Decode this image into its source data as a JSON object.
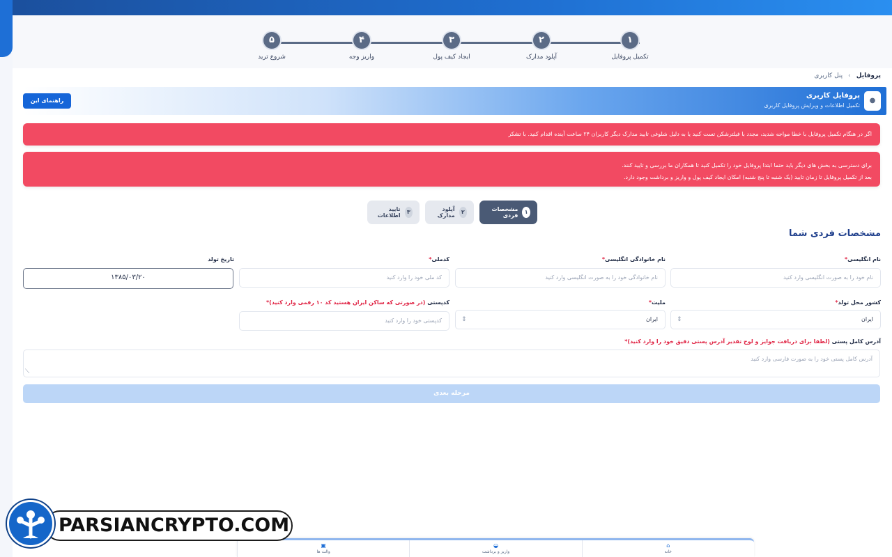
{
  "stepper": {
    "steps": [
      {
        "num": "۱",
        "label": "تکمیل پروفایل"
      },
      {
        "num": "۲",
        "label": "آپلود مدارک"
      },
      {
        "num": "۳",
        "label": "ایجاد کیف پول"
      },
      {
        "num": "۴",
        "label": "واریز وجه"
      },
      {
        "num": "۵",
        "label": "شروع ترید"
      }
    ]
  },
  "breadcrumb": {
    "root": "پنل کاربری",
    "separator": "›",
    "current": "پروفایل"
  },
  "hero": {
    "title": "پروفایل کاربری",
    "subtitle": "تکمیل اطلاعات و ویرایش پروفایل کاربری",
    "guide_button": "راهنمای این بخش",
    "icon": "profile-icon"
  },
  "alerts": {
    "alert1": "اگر در هنگام تکمیل پروفایل با خطا مواجه شدید، مجدد با فیلترشکن تست کنید یا به دلیل شلوغی تایید مدارک دیگر کاربران ۲۴ ساعت آینده اقدام کنید. با تشکر",
    "alert2_line1": "برای دسترسی به بخش های دیگر باید حتما ابتدا پروفایل خود را تکمیل کنید تا همکاران ما بررسی و تایید کنند.",
    "alert2_line2": "بعد از تکمیل پروفایل تا زمان تایید (یک شنبه تا پنج شنبه) امکان ایجاد کیف پول و واریز و برداشت وجود دارد."
  },
  "tabs": [
    {
      "num": "۱",
      "label": "مشخصات فردی"
    },
    {
      "num": "۲",
      "label": "آپلود مدارک"
    },
    {
      "num": "۳",
      "label": "تایید اطلاعات"
    }
  ],
  "form": {
    "section_title": "مشخصات فردی شما",
    "required_mark": "*",
    "english_name": {
      "label": "نام انگلیسی",
      "placeholder": "نام خود را به صورت انگلیسی وارد کنید"
    },
    "english_family": {
      "label": "نام خانوادگی انگلیسی",
      "placeholder": "نام خانوادگی خود را به صورت انگلیسی وارد کنید"
    },
    "national_code": {
      "label": "کدملی",
      "placeholder": "کد ملی خود را وارد کنید"
    },
    "birth_date": {
      "label": "تاریخ تولد",
      "value": "۱۳۸۵/۰۳/۲۰"
    },
    "birth_country": {
      "label": "کشور محل تولد",
      "value": "ایران"
    },
    "nationality": {
      "label": "ملیت",
      "value": "ایران"
    },
    "postal_code": {
      "label": "کدپستی",
      "note": "(در صورتی که ساکن ایران هستید کد ۱۰ رقمی وارد کنید)",
      "placeholder": "کدپستی خود را وارد کنید"
    },
    "address": {
      "label": "آدرس کامل پستی",
      "note": "(لطفا برای دریافت جوایز و لوح تقدیر آدرس پستی دقیق خود را وارد کنید)",
      "placeholder": "آدرس کامل پستی خود را به صورت فارسی وارد کنید"
    },
    "next_button": "مرحله بعدی"
  },
  "bottom_nav": [
    {
      "icon": "home-icon",
      "label": "خانه"
    },
    {
      "icon": "wallet-icon",
      "label": "واریز و برداشت"
    },
    {
      "icon": "wallet-card-icon",
      "label": "والت ها"
    }
  ],
  "watermark": {
    "text": "PARSIANCRYPTO.COM"
  },
  "colors": {
    "brand_blue": "#1f6fd6",
    "alert_red": "#f24a62",
    "step_gray": "#5b6b86",
    "next_disabled": "#bcd6f7"
  }
}
